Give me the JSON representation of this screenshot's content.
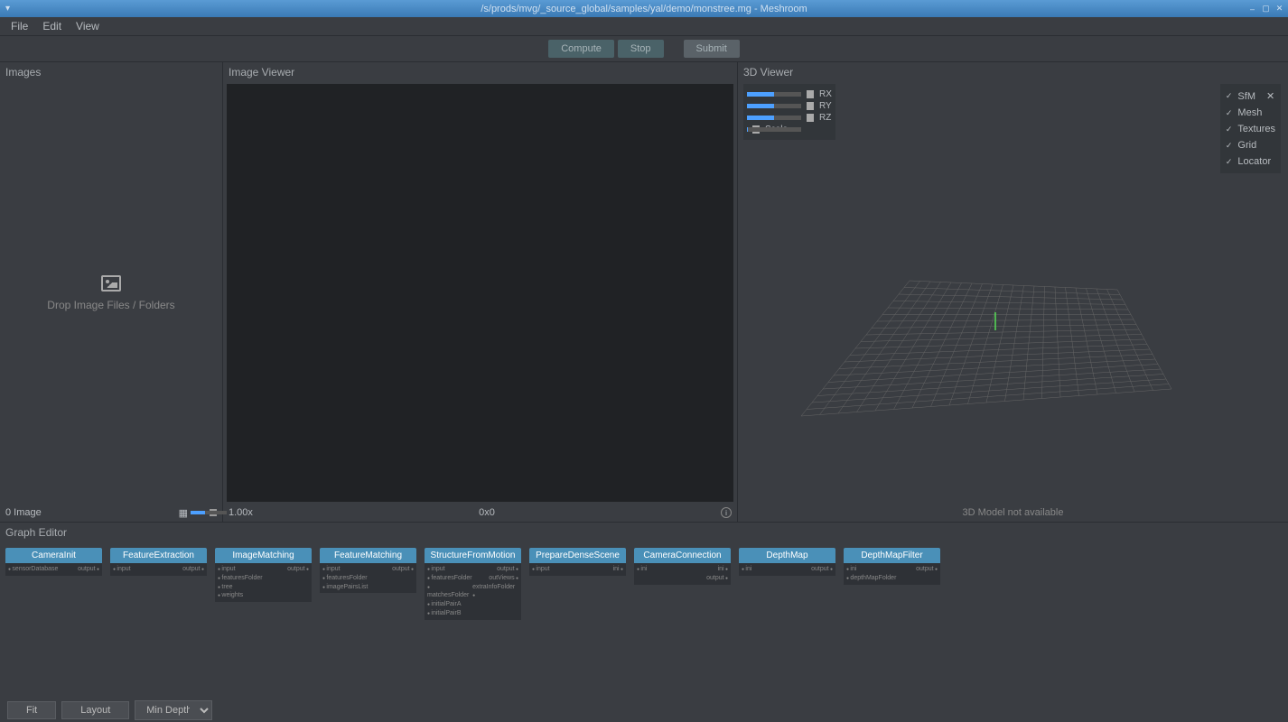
{
  "window": {
    "title": "/s/prods/mvg/_source_global/samples/yal/demo/monstree.mg - Meshroom"
  },
  "menu": {
    "file": "File",
    "edit": "Edit",
    "view": "View"
  },
  "toolbar": {
    "compute": "Compute",
    "stop": "Stop",
    "submit": "Submit"
  },
  "images": {
    "title": "Images",
    "drop": "Drop Image Files / Folders",
    "count": "0 Image"
  },
  "imageviewer": {
    "title": "Image Viewer",
    "zoom": "1.00x",
    "res": "0x0"
  },
  "viewer3d": {
    "title": "3D Viewer",
    "rx": "RX",
    "ry": "RY",
    "rz": "RZ",
    "scale": "Scale",
    "layers": {
      "sfm": "SfM",
      "mesh": "Mesh",
      "textures": "Textures",
      "grid": "Grid",
      "locator": "Locator"
    },
    "unavailable": "3D Model not available"
  },
  "graph": {
    "title": "Graph Editor",
    "fit": "Fit",
    "layout": "Layout",
    "mindepth": "Min Depth",
    "nodes": [
      {
        "name": "CameraInit",
        "inputs": [
          "sensorDatabase"
        ],
        "outputs": [
          "output"
        ]
      },
      {
        "name": "FeatureExtraction",
        "inputs": [
          "input"
        ],
        "outputs": [
          "output"
        ]
      },
      {
        "name": "ImageMatching",
        "inputs": [
          "input",
          "featuresFolder",
          "tree",
          "weights"
        ],
        "outputs": [
          "output"
        ]
      },
      {
        "name": "FeatureMatching",
        "inputs": [
          "input",
          "featuresFolder",
          "imagePairsList"
        ],
        "outputs": [
          "output"
        ]
      },
      {
        "name": "StructureFromMotion",
        "inputs": [
          "input",
          "featuresFolder",
          "matchesFolder",
          "initialPairA",
          "initialPairB"
        ],
        "outputs": [
          "output",
          "outViews",
          "extraInfoFolder"
        ]
      },
      {
        "name": "PrepareDenseScene",
        "inputs": [
          "input"
        ],
        "outputs": [
          "ini"
        ]
      },
      {
        "name": "CameraConnection",
        "inputs": [
          "ini"
        ],
        "outputs": [
          "ini",
          "output"
        ]
      },
      {
        "name": "DepthMap",
        "inputs": [
          "ini"
        ],
        "outputs": [
          "output"
        ]
      },
      {
        "name": "DepthMapFilter",
        "inputs": [
          "ini",
          "depthMapFolder"
        ],
        "outputs": [
          "output"
        ]
      }
    ]
  }
}
